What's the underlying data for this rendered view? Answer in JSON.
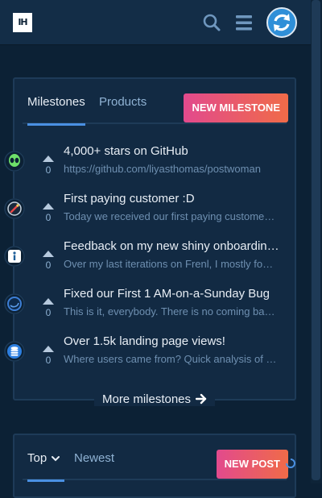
{
  "header": {
    "logo": "IH",
    "search_icon": "search-icon",
    "menu_icon": "hamburger-menu-icon",
    "avatar_icon": "refresh-avatar-icon",
    "loading_progress": 0.28
  },
  "milestones_card": {
    "tabs": [
      {
        "label": "Milestones",
        "active": true
      },
      {
        "label": "Products",
        "active": false
      }
    ],
    "new_button": "New Milestone",
    "items": [
      {
        "icon": "alien-icon",
        "votes": "0",
        "title": "4,000+ stars on GitHub",
        "description": "https://github.com/liyasthomas/postwoman"
      },
      {
        "icon": "rocket-icon",
        "votes": "0",
        "title": "First paying customer :D",
        "description": "Today we received our first paying customer after launch"
      },
      {
        "icon": "info-icon",
        "votes": "0",
        "title": "Feedback on my new shiny onboarding flow",
        "description": "Over my last iterations on Frenl, I mostly focused on"
      },
      {
        "icon": "bug-ring-icon",
        "votes": "0",
        "title": "Fixed our First 1 AM-on-a-Sunday Bug",
        "description": "This is it, everybody. There is no coming back now"
      },
      {
        "icon": "database-icon",
        "votes": "0",
        "title": "Over 1.5k landing page views!",
        "description": "Where users came from? Quick analysis of traffic"
      }
    ],
    "more_link": "More milestones",
    "more_icon": "arrow-right-icon"
  },
  "posts_card": {
    "tabs": [
      {
        "label": "Top",
        "active": true
      },
      {
        "label": "Newest",
        "active": false
      }
    ],
    "dropdown_icon": "chevron-down-icon",
    "new_button": "New Post"
  },
  "colors": {
    "background": "#0c2135",
    "card": "#122a43",
    "accent": "#4a90e2",
    "button_gradient_start": "#e24a8d",
    "button_gradient_end": "#f06b48"
  }
}
